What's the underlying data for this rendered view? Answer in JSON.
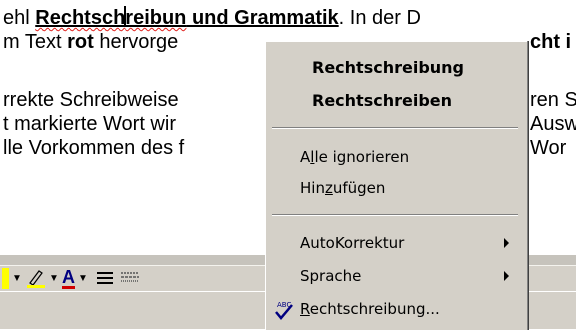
{
  "document": {
    "line1": {
      "a": "ehl ",
      "b": "Rechtsch",
      "c": "reibun",
      "d": " und Grammatik",
      "e": ". In der D"
    },
    "line2": {
      "a": "m Text ",
      "b": "rot",
      "c": " hervorge",
      "d": "cht i"
    },
    "line3": {
      "a": "rrekte Schreibweise",
      "b": "ren S"
    },
    "line4": {
      "a": "t markierte Wort wir",
      "b": "Ausw"
    },
    "line5": {
      "a": "lle Vorkommen des f",
      "b": "Wor"
    }
  },
  "context_menu": {
    "suggestions": [
      "Rechtschreibung",
      "Rechtschreiben"
    ],
    "ignore_all": {
      "pre": "A",
      "acc": "l",
      "post": "le ignorieren"
    },
    "add": {
      "pre": "Hin",
      "acc": "z",
      "post": "ufügen"
    },
    "autocorrect": "AutoKorrektur",
    "language": "Sprache",
    "spelling": {
      "pre": "",
      "acc": "R",
      "post": "echtschreibung..."
    }
  },
  "colors": {
    "highlight": "#ffff00",
    "font_color": "#d00000",
    "underline_wavy": "#e0201c"
  },
  "icons": [
    "highlighter-icon",
    "font-color-icon",
    "line-style-icon",
    "dash-style-icon",
    "spelling-check-icon"
  ]
}
